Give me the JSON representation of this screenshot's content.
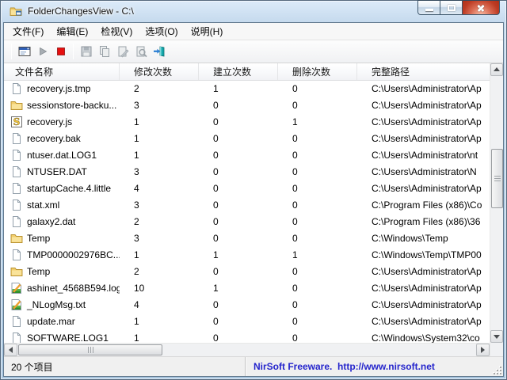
{
  "window": {
    "title": "FolderChangesView - C:\\",
    "controls": [
      {
        "id": "minimize-button",
        "icon": "minimize-icon"
      },
      {
        "id": "maximize-button",
        "icon": "maximize-icon"
      },
      {
        "id": "close-button",
        "icon": "close-icon"
      }
    ]
  },
  "menu": {
    "items": [
      {
        "id": "menu-file",
        "label": "文件(F)"
      },
      {
        "id": "menu-edit",
        "label": "编辑(E)"
      },
      {
        "id": "menu-view",
        "label": "检视(V)"
      },
      {
        "id": "menu-options",
        "label": "选项(O)"
      },
      {
        "id": "menu-help",
        "label": "说明(H)"
      }
    ]
  },
  "toolbar": {
    "buttons": [
      {
        "name": "choose-folder",
        "icon": "folder-dialog-icon",
        "enabled": true
      },
      {
        "name": "start-monitoring",
        "icon": "play-icon",
        "enabled": false
      },
      {
        "name": "stop-monitoring",
        "icon": "stop-icon",
        "enabled": true
      },
      {
        "name": "save",
        "icon": "floppy-icon",
        "enabled": false
      },
      {
        "name": "copy",
        "icon": "copy-icon",
        "enabled": false
      },
      {
        "name": "properties",
        "icon": "properties-icon",
        "enabled": false
      },
      {
        "name": "find",
        "icon": "magnifier-icon",
        "enabled": false
      },
      {
        "name": "exit",
        "icon": "exit-door-icon",
        "enabled": true
      }
    ]
  },
  "table": {
    "columns": [
      {
        "id": "column-header-filename",
        "label": "文件名称"
      },
      {
        "id": "column-header-modified-count",
        "label": "修改次数"
      },
      {
        "id": "column-header-created-count",
        "label": "建立次数"
      },
      {
        "id": "column-header-deleted-count",
        "label": "删除次数"
      },
      {
        "id": "column-header-full-path",
        "label": "完整路径"
      }
    ],
    "rows": [
      {
        "icon": "file",
        "name": "recovery.js.tmp",
        "modified": "2",
        "created": "1",
        "deleted": "0",
        "path": "C:\\Users\\Administrator\\Ap"
      },
      {
        "icon": "folder",
        "name": "sessionstore-backu...",
        "modified": "3",
        "created": "0",
        "deleted": "0",
        "path": "C:\\Users\\Administrator\\Ap"
      },
      {
        "icon": "script",
        "name": "recovery.js",
        "modified": "1",
        "created": "0",
        "deleted": "1",
        "path": "C:\\Users\\Administrator\\Ap"
      },
      {
        "icon": "file",
        "name": "recovery.bak",
        "modified": "1",
        "created": "0",
        "deleted": "0",
        "path": "C:\\Users\\Administrator\\Ap"
      },
      {
        "icon": "file",
        "name": "ntuser.dat.LOG1",
        "modified": "1",
        "created": "0",
        "deleted": "0",
        "path": "C:\\Users\\Administrator\\nt"
      },
      {
        "icon": "file",
        "name": "NTUSER.DAT",
        "modified": "3",
        "created": "0",
        "deleted": "0",
        "path": "C:\\Users\\Administrator\\N"
      },
      {
        "icon": "file",
        "name": "startupCache.4.little",
        "modified": "4",
        "created": "0",
        "deleted": "0",
        "path": "C:\\Users\\Administrator\\Ap"
      },
      {
        "icon": "file",
        "name": "stat.xml",
        "modified": "3",
        "created": "0",
        "deleted": "0",
        "path": "C:\\Program Files (x86)\\Co"
      },
      {
        "icon": "file",
        "name": "galaxy2.dat",
        "modified": "2",
        "created": "0",
        "deleted": "0",
        "path": "C:\\Program Files (x86)\\36"
      },
      {
        "icon": "folder",
        "name": "Temp",
        "modified": "3",
        "created": "0",
        "deleted": "0",
        "path": "C:\\Windows\\Temp"
      },
      {
        "icon": "file",
        "name": "TMP0000002976BC...",
        "modified": "1",
        "created": "1",
        "deleted": "1",
        "path": "C:\\Windows\\Temp\\TMP00"
      },
      {
        "icon": "folder",
        "name": "Temp",
        "modified": "2",
        "created": "0",
        "deleted": "0",
        "path": "C:\\Users\\Administrator\\Ap"
      },
      {
        "icon": "log",
        "name": "ashinet_4568B594.log",
        "modified": "10",
        "created": "1",
        "deleted": "0",
        "path": "C:\\Users\\Administrator\\Ap"
      },
      {
        "icon": "log",
        "name": "_NLogMsg.txt",
        "modified": "4",
        "created": "0",
        "deleted": "0",
        "path": "C:\\Users\\Administrator\\Ap"
      },
      {
        "icon": "file",
        "name": "update.mar",
        "modified": "1",
        "created": "0",
        "deleted": "0",
        "path": "C:\\Users\\Administrator\\Ap"
      },
      {
        "icon": "file",
        "name": "SOFTWARE.LOG1",
        "modified": "1",
        "created": "0",
        "deleted": "0",
        "path": "C:\\Windows\\System32\\co"
      }
    ]
  },
  "statusbar": {
    "items_count": "20 个项目",
    "branding": "NirSoft Freeware.  http://www.nirsoft.net",
    "branding_color": "#2525cc"
  }
}
